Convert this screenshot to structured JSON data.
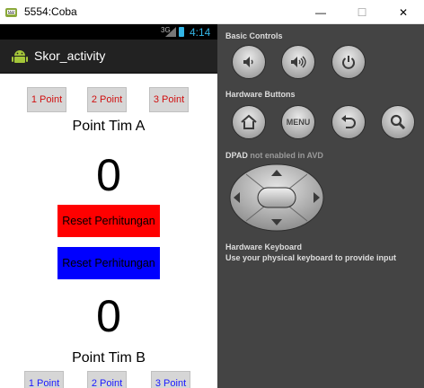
{
  "window": {
    "title": "5554:Coba",
    "minimize_glyph": "—",
    "maximize_glyph": "☐",
    "close_glyph": "✕"
  },
  "statusbar": {
    "network": "3G",
    "time": "4:14"
  },
  "actionbar": {
    "title": "Skor_activity"
  },
  "team_a": {
    "buttons": [
      "1 Point",
      "2 Point",
      "3 Point"
    ],
    "label": "Point Tim A",
    "score": "0",
    "reset_label": "Reset Perhitungan"
  },
  "team_b": {
    "reset_label": "Reset Perhitungan",
    "score": "0",
    "label": "Point Tim B",
    "buttons": [
      "1 Point",
      "2 Point",
      "3 Point"
    ]
  },
  "controls": {
    "basic_title": "Basic Controls",
    "hardware_title": "Hardware Buttons",
    "menu_label": "MENU",
    "dpad_title": "DPAD",
    "dpad_note": "not enabled in AVD",
    "keyboard_title": "Hardware Keyboard",
    "keyboard_note": "Use your physical keyboard to provide input"
  },
  "colors": {
    "reset_a": "#ff0000",
    "reset_b": "#0000ff",
    "time": "#33b5e5",
    "panel_bg": "#444444"
  },
  "icons": [
    "emulator-app-icon",
    "signal-icon",
    "battery-icon",
    "android-icon",
    "volume-down-icon",
    "volume-up-icon",
    "power-icon",
    "home-icon",
    "back-icon",
    "search-icon",
    "dpad-icon"
  ]
}
